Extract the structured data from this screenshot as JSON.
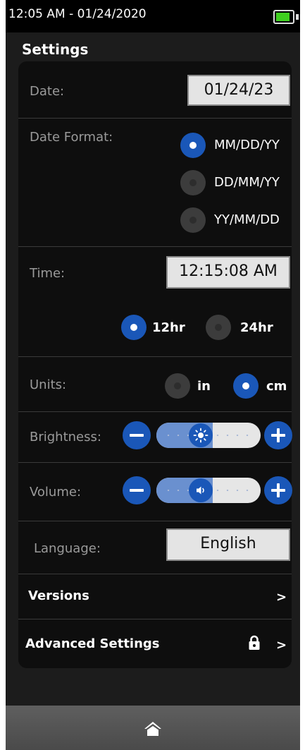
{
  "status": {
    "datetime": "12:05 AM  - 01/24/2020",
    "battery_level": 0.85,
    "battery_color": "#3fcf1f"
  },
  "title": "Settings",
  "date": {
    "label": "Date:",
    "value": "01/24/23"
  },
  "date_format": {
    "label": "Date Format:",
    "options": [
      "MM/DD/YY",
      "DD/MM/YY",
      "YY/MM/DD"
    ],
    "selected": "MM/DD/YY"
  },
  "time": {
    "label": "Time:",
    "value": "12:15:08 AM",
    "options": [
      "12hr",
      "24hr"
    ],
    "selected": "12hr"
  },
  "units": {
    "label": "Units:",
    "options": [
      "in",
      "cm"
    ],
    "selected": "cm"
  },
  "brightness": {
    "label": "Brightness:",
    "level": 0.4,
    "icon": "sun-icon"
  },
  "volume": {
    "label": "Volume:",
    "level": 0.4,
    "icon": "speaker-icon"
  },
  "language": {
    "label": "Language:",
    "value": "English"
  },
  "versions": {
    "label": "Versions",
    "chevron": ">"
  },
  "advanced": {
    "label": "Advanced Settings",
    "chevron": ">",
    "icon": "lock-icon"
  },
  "nav": {
    "icon": "home-icon"
  },
  "colors": {
    "accent": "#1a57b8",
    "panel": "#0e0e0e",
    "background": "#1c1c1c"
  }
}
